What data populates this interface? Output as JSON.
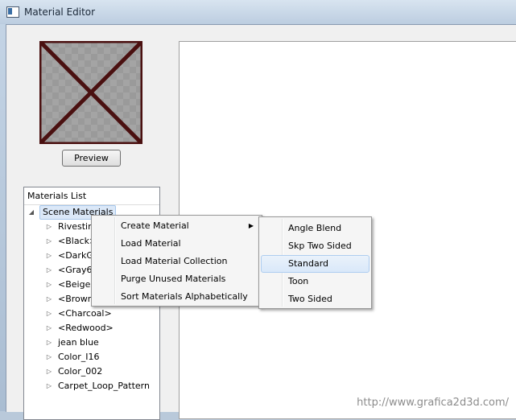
{
  "window": {
    "title": "Material Editor"
  },
  "preview": {
    "button_label": "Preview"
  },
  "materials_list": {
    "header": "Materials List",
    "root": {
      "label": "Scene Materials",
      "expanded": true
    },
    "items": [
      "Rivestin",
      "<Black>",
      "<DarkG",
      "<Gray6",
      "<Beige>",
      "<Brown",
      "<Charcoal>",
      "<Redwood>",
      "jean blue",
      "Color_I16",
      "Color_002",
      "Carpet_Loop_Pattern"
    ]
  },
  "context_menu": {
    "items": [
      "Create Material",
      "Load Material",
      "Load Material Collection",
      "Purge Unused Materials",
      "Sort Materials Alphabetically"
    ],
    "submenu_parent": "Create Material"
  },
  "submenu": {
    "items": [
      "Angle Blend",
      "Skp Two Sided",
      "Standard",
      "Toon",
      "Two Sided"
    ],
    "highlighted": "Standard"
  },
  "watermark": "http://www.grafica2d3d.com/",
  "colors": {
    "window_frame": "#b9c9da",
    "client_bg": "#f0f0f0",
    "preview_cross": "#4a1010",
    "menu_highlight": "#d9e8f9"
  },
  "icons": {
    "tree_expanded": "triangle-down-icon",
    "tree_collapsed": "triangle-right-icon",
    "submenu": "chevron-right-icon"
  }
}
